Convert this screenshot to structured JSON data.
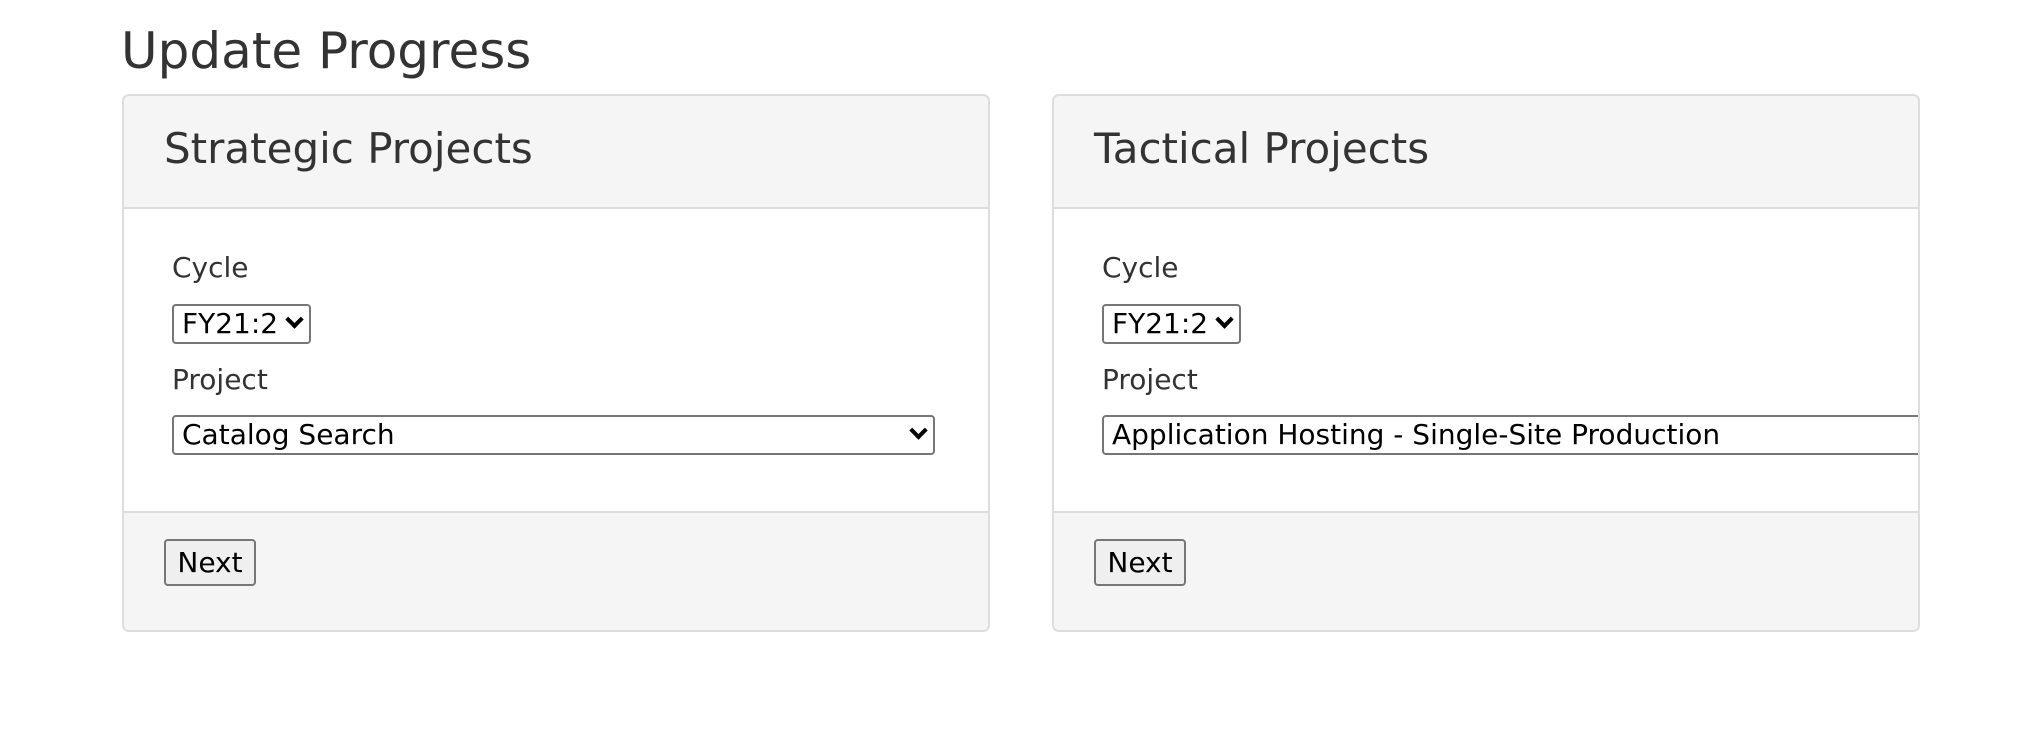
{
  "page": {
    "title": "Update Progress"
  },
  "strategic": {
    "heading": "Strategic Projects",
    "cycle_label": "Cycle",
    "cycle_value": "FY21:2",
    "project_label": "Project",
    "project_value": "Catalog Search",
    "next_label": "Next"
  },
  "tactical": {
    "heading": "Tactical Projects",
    "cycle_label": "Cycle",
    "cycle_value": "FY21:2",
    "project_label": "Project",
    "project_value": "Application Hosting - Single-Site Production",
    "next_label": "Next"
  },
  "icons": {
    "dropdown": "chevron-down-icon"
  },
  "colors": {
    "text": "#333333",
    "panel_header_bg": "#f5f5f5",
    "panel_border": "#dddddd"
  }
}
